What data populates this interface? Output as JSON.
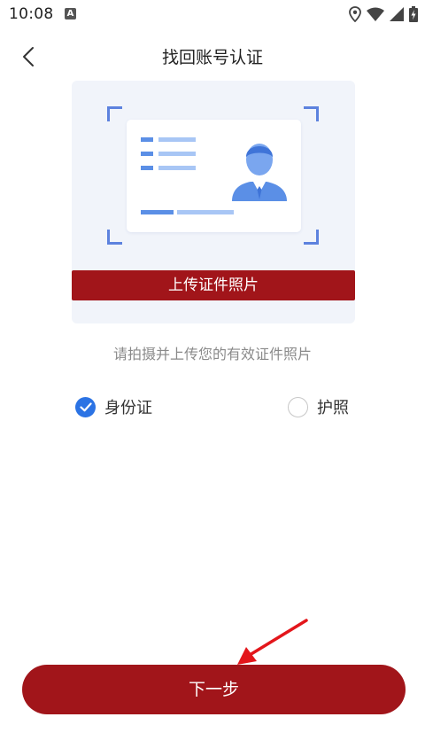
{
  "status_bar": {
    "time": "10:08",
    "notification_badge": "A",
    "icons": [
      "location-icon",
      "wifi-icon",
      "signal-icon",
      "battery-icon"
    ]
  },
  "header": {
    "title": "找回账号认证",
    "back_icon": "chevron-left-icon"
  },
  "upload": {
    "button_label": "上传证件照片"
  },
  "hint": "请拍摄并上传您的有效证件照片",
  "document_type": {
    "options": [
      {
        "label": "身份证",
        "checked": true
      },
      {
        "label": "护照",
        "checked": false
      }
    ]
  },
  "next_button": {
    "label": "下一步"
  },
  "colors": {
    "brand_red": "#a1151a",
    "check_blue": "#2b73e4",
    "frame_blue": "#5d82de",
    "annotation_red": "#e3161b"
  }
}
